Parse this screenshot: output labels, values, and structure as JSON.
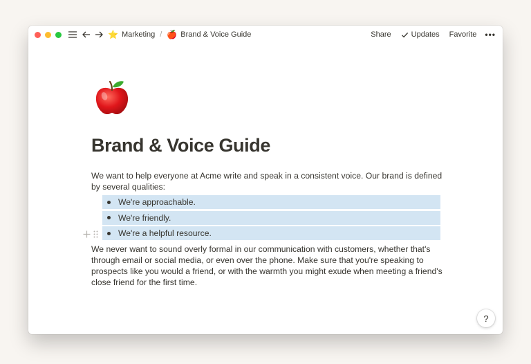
{
  "topbar": {
    "breadcrumb": [
      {
        "icon": "star-icon",
        "emoji": "⭐",
        "label": "Marketing"
      },
      {
        "icon": "apple-icon",
        "emoji": "🍎",
        "label": "Brand & Voice Guide"
      }
    ],
    "separator": "/",
    "share_label": "Share",
    "updates_label": "Updates",
    "favorite_label": "Favorite",
    "more_label": "•••"
  },
  "page": {
    "title": "Brand & Voice Guide",
    "intro": "We want to help everyone at Acme write and speak in a consistent voice. Our brand is defined by several qualities:",
    "bullets": [
      "We're approachable.",
      "We're friendly.",
      "We're a helpful resource."
    ],
    "closing": "We never want to sound overly formal in our communication with customers, whether that's through email or social media, or even over the phone. Make sure that you're speaking to prospects like you would a friend, or with the warmth you might exude when meeting a friend's close friend for the first time."
  },
  "help_label": "?",
  "colors": {
    "background": "#f8f5f1",
    "text": "#37352f",
    "selection": "#d3e5f3",
    "red": "#ff5f57",
    "yellow": "#febc2e",
    "green": "#28c840"
  }
}
